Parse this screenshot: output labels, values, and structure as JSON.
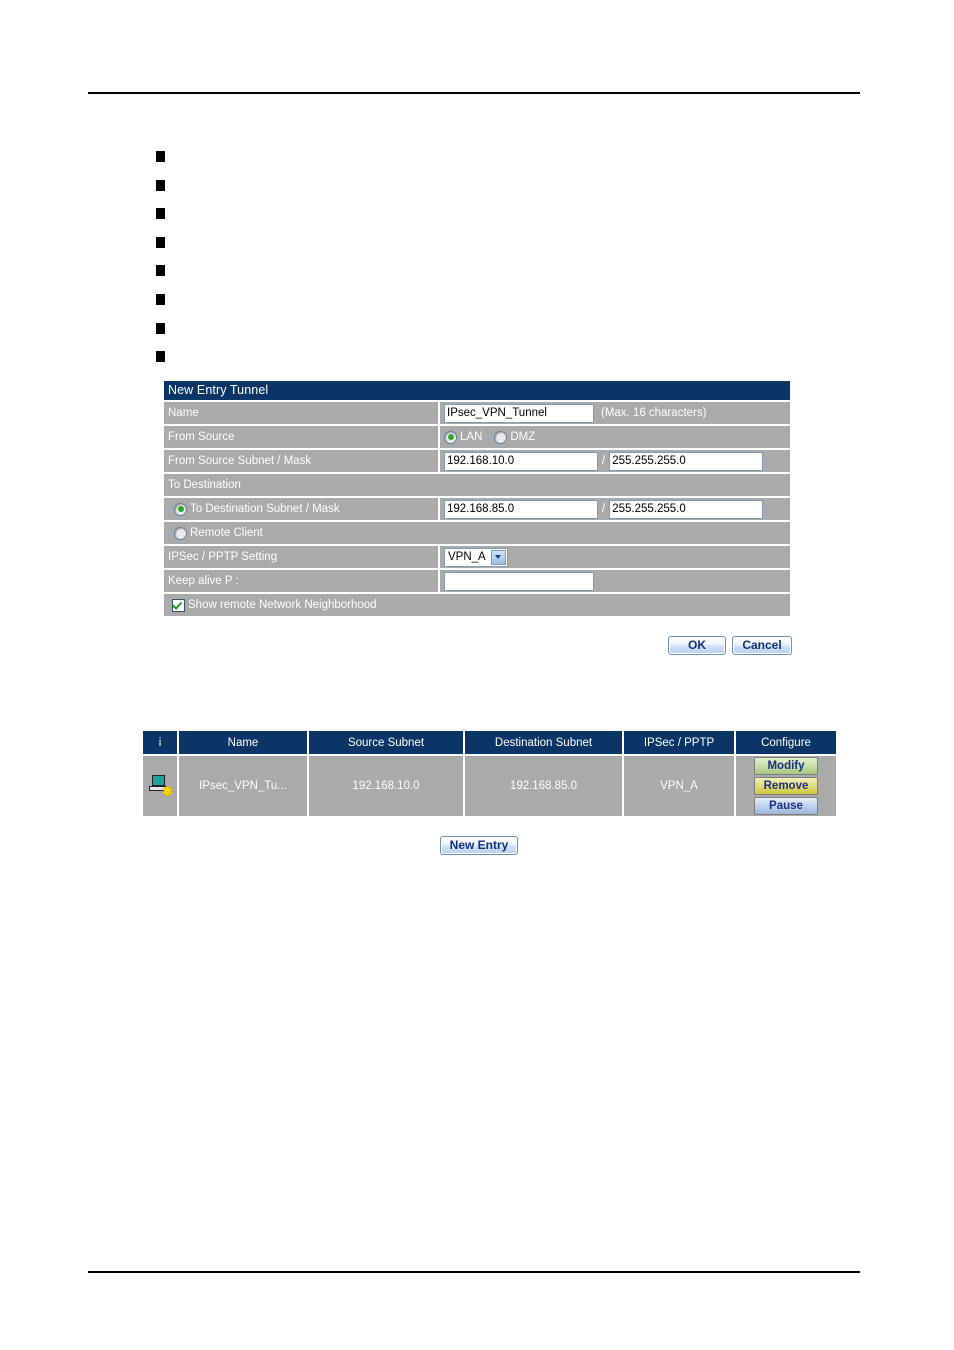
{
  "page": {
    "bullets": [
      "",
      "",
      "",
      "",
      "",
      "",
      "",
      ""
    ]
  },
  "form": {
    "title": "New Entry Tunnel",
    "rows": {
      "name": {
        "label": "Name",
        "value": "IPsec_VPN_Tunnel",
        "placeholder": "",
        "hint": "(Max. 16 characters)"
      },
      "from_source": {
        "label": "From Source",
        "options": [
          "LAN",
          "DMZ"
        ],
        "selected": "LAN"
      },
      "from_subnet": {
        "label": "From Source Subnet / Mask",
        "subnet": "192.168.10.0",
        "separator": "/",
        "mask": "255.255.255.0"
      },
      "to_destination": {
        "label": "To Destination"
      },
      "to_subnet": {
        "label": "To Destination Subnet / Mask",
        "selected": true,
        "subnet": "192.168.85.0",
        "separator": "/",
        "mask": "255.255.255.0"
      },
      "remote_client": {
        "label": "Remote Client",
        "selected": false
      },
      "ipsec_setting": {
        "label": "IPSec / PPTP Setting",
        "value": "VPN_A",
        "options": [
          "VPN_A"
        ]
      },
      "keep_alive": {
        "label": "Keep alive P :",
        "value": "",
        "placeholder": ""
      },
      "show_neighborhood": {
        "label": "Show remote Network Neighborhood",
        "checked": true
      }
    },
    "buttons": {
      "ok": "OK",
      "cancel": "Cancel"
    }
  },
  "entries_table": {
    "columns": [
      "i",
      "Name",
      "Source Subnet",
      "Destination Subnet",
      "IPSec / PPTP",
      "Configure"
    ],
    "rows": [
      {
        "status_icon": "computer-disconnected-icon",
        "name": "IPsec_VPN_Tu...",
        "source_subnet": "192.168.10.0",
        "destination_subnet": "192.168.85.0",
        "ipsec_pptp": "VPN_A",
        "configure": {
          "modify": "Modify",
          "remove": "Remove",
          "pause": "Pause"
        }
      }
    ],
    "new_entry_button": "New Entry"
  },
  "colors": {
    "header_navy": "#0b3566",
    "row_gray": "#aaaaaa",
    "btn_green": "#a8c77d",
    "btn_yellow": "#cdc83a",
    "btn_blue": "#9ab6d9",
    "radio_dot_green": "#2fa828",
    "check_green": "#1f9c22",
    "btn_text_blue": "#13307a"
  }
}
